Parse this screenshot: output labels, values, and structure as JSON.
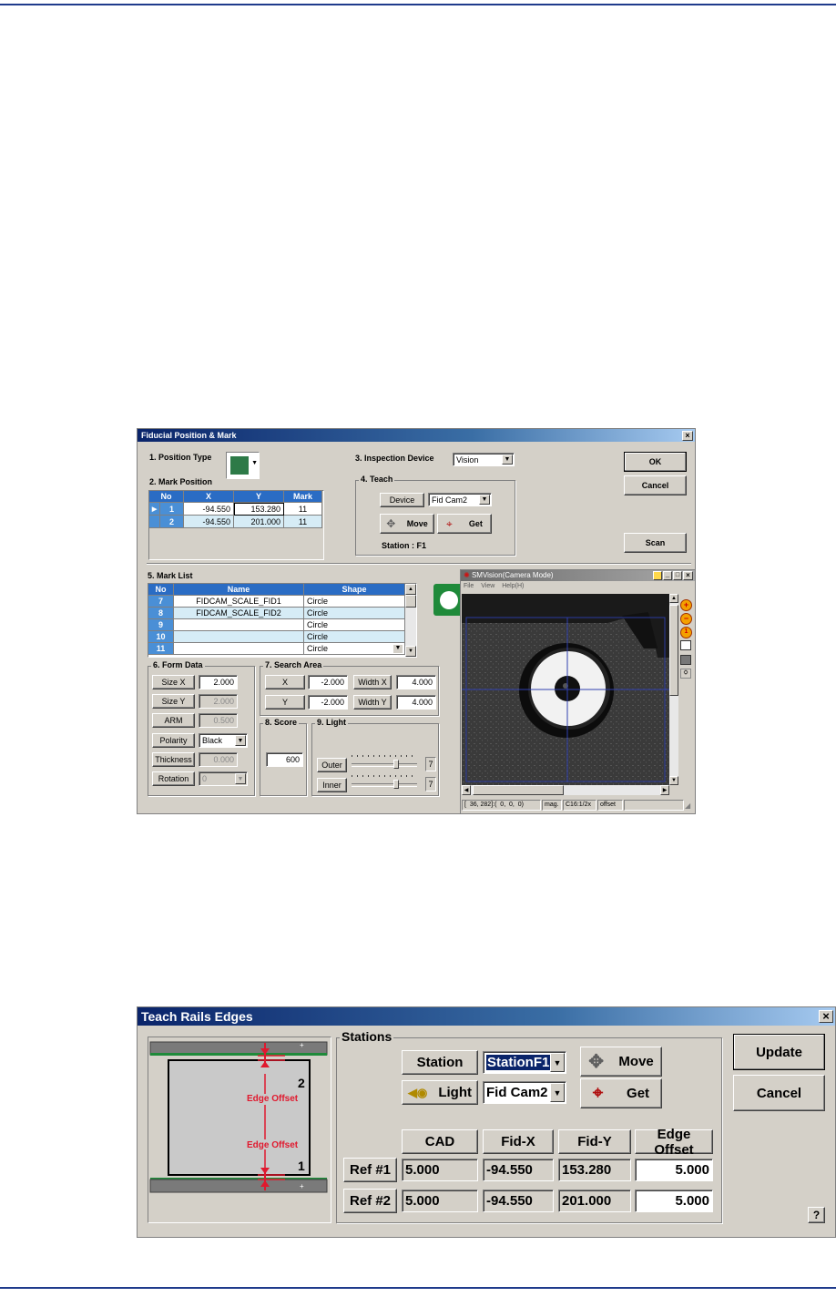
{
  "fiducial": {
    "title": "Fiducial Position & Mark",
    "close": "×",
    "position_type_label": "1. Position Type",
    "mark_position_label": "2. Mark Position",
    "mark_position_table": {
      "headers": [
        "No",
        "X",
        "Y",
        "Mark"
      ],
      "rows": [
        {
          "no": "1",
          "x": "-94.550",
          "y": "153.280",
          "mark": "11"
        },
        {
          "no": "2",
          "x": "-94.550",
          "y": "201.000",
          "mark": "11"
        }
      ]
    },
    "inspection_device_label": "3. Inspection Device",
    "inspection_device_value": "Vision",
    "teach_label": "4. Teach",
    "device_button": "Device",
    "device_value": "Fid Cam2",
    "move_button": "Move",
    "get_button": "Get",
    "station_text": "Station :  F1",
    "ok_button": "OK",
    "cancel_button": "Cancel",
    "scan_button": "Scan",
    "mark_list_label": "5. Mark List",
    "mark_list_table": {
      "headers": [
        "No",
        "Name",
        "Shape"
      ],
      "rows": [
        {
          "no": "7",
          "name": "FIDCAM_SCALE_FID1",
          "shape": "Circle"
        },
        {
          "no": "8",
          "name": "FIDCAM_SCALE_FID2",
          "shape": "Circle"
        },
        {
          "no": "9",
          "name": "",
          "shape": "Circle"
        },
        {
          "no": "10",
          "name": "",
          "shape": "Circle"
        },
        {
          "no": "11",
          "name": "",
          "shape": "Circle"
        }
      ]
    },
    "form_data_label": "6. Form Data",
    "form": {
      "size_x_label": "Size X",
      "size_x_value": "2.000",
      "size_y_label": "Size Y",
      "size_y_value": "2.000",
      "arm_label": "ARM",
      "arm_value": "0.500",
      "polarity_label": "Polarity",
      "polarity_value": "Black",
      "thickness_label": "Thickness",
      "thickness_value": "0.000",
      "rotation_label": "Rotation",
      "rotation_value": "0"
    },
    "search_area_label": "7. Search Area",
    "search": {
      "x_label": "X",
      "x_value": "-2.000",
      "y_label": "Y",
      "y_value": "-2.000",
      "width_x_label": "Width X",
      "width_x_value": "4.000",
      "width_y_label": "Width Y",
      "width_y_value": "4.000"
    },
    "score_label": "8. Score",
    "score_value": "600",
    "light_label": "9. Light",
    "outer_label": "Outer",
    "outer_value": "7",
    "inner_label": "Inner",
    "inner_value": "7"
  },
  "vision": {
    "title": "SMVision(Camera Mode)",
    "menu": [
      "File",
      "View",
      "Help(H)"
    ],
    "status_coords": "[  36, 282]:(  0,  0,  0)",
    "status_mag": "mag.",
    "status_cam": "C16:1/2x",
    "status_offset": "offset"
  },
  "rails": {
    "title": "Teach Rails Edges",
    "close": "×",
    "stations_label": "Stations",
    "station_button": "Station",
    "station_value": "StationF1",
    "move_button": "Move",
    "light_button": "Light",
    "camera_value": "Fid Cam2",
    "get_button": "Get",
    "headers": {
      "cad": "CAD",
      "fid_x": "Fid-X",
      "fid_y": "Fid-Y",
      "edge_offset": "Edge Offset"
    },
    "refs": [
      {
        "label": "Ref #1",
        "cad": "5.000",
        "fid_x": "-94.550",
        "fid_y": "153.280",
        "edge_offset": "5.000"
      },
      {
        "label": "Ref #2",
        "cad": "5.000",
        "fid_x": "-94.550",
        "fid_y": "201.000",
        "edge_offset": "5.000"
      }
    ],
    "update_button": "Update",
    "cancel_button": "Cancel",
    "help_button": "?",
    "diagram": {
      "edge_offset_label_top": "Edge Offset",
      "edge_offset_label_bottom": "Edge Offset",
      "rail_num_top": "2",
      "rail_num_bottom": "1",
      "accent": "#e0192e",
      "rail_green": "#1f8a3a"
    }
  }
}
